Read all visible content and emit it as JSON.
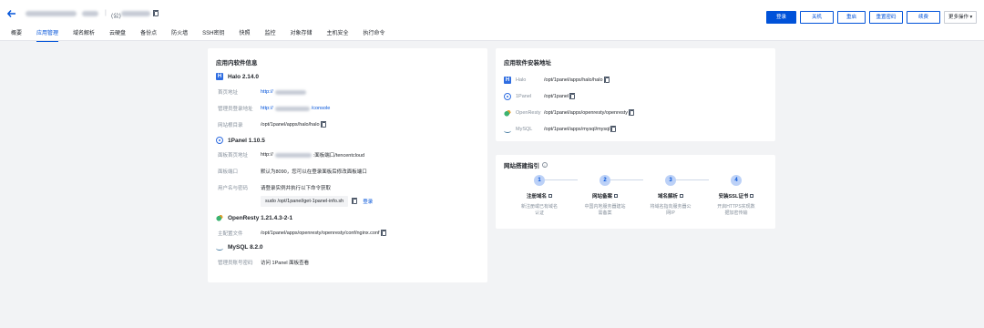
{
  "header": {
    "ip_prefix": "(公)",
    "buttons": [
      "登录",
      "关机",
      "重启",
      "重置密码",
      "续费",
      "更多操作"
    ]
  },
  "tabs": [
    "概要",
    "应用管理",
    "域名解析",
    "云硬盘",
    "备份点",
    "防火墙",
    "SSH密钥",
    "快照",
    "监控",
    "对象存储",
    "主机安全",
    "执行命令"
  ],
  "active_tab": "应用管理",
  "software_info": {
    "title": "应用内软件信息",
    "halo": {
      "name": "Halo 2.14.0",
      "homepage_label": "首页地址",
      "homepage_value": "http://",
      "admin_label": "管理员登录地址",
      "admin_value_prefix": "http://",
      "admin_value_suffix": "/console",
      "path_label": "网站根目录",
      "path_value": "/opt/1panel/apps/halo/halo"
    },
    "onepanel": {
      "name": "1Panel 1.10.5",
      "panel_label": "面板首页地址",
      "panel_value_prefix": "http://",
      "panel_value_suffix": ":面板端口/tencentcloud",
      "port_label": "面板端口",
      "port_value": "默认为8090，您可以在登录面板后修改面板端口",
      "cred_label": "用户名与密码",
      "cred_value": "请登录实例并执行以下命令获取",
      "command": "sudo /opt/1panel/get-1panel-info.sh",
      "login_link": "登录"
    },
    "openresty": {
      "name": "OpenResty 1.21.4.3-2-1",
      "config_label": "主配置文件",
      "config_value": "/opt/1panel/apps/openresty/openresty/conf/nginx.conf"
    },
    "mysql": {
      "name": "MySQL 8.2.0",
      "pwd_label": "管理员账号密码",
      "pwd_value": "访问 1Panel 面板查看"
    }
  },
  "install_paths": {
    "title": "应用软件安装地址",
    "items": [
      {
        "name": "Halo",
        "path": "/opt/1panel/apps/halo/halo",
        "icon": "halo-icon"
      },
      {
        "name": "1Panel",
        "path": "/opt/1panel",
        "icon": "1panel-icon"
      },
      {
        "name": "OpenResty",
        "path": "/opt/1panel/apps/openresty/openresty",
        "icon": "openresty-icon"
      },
      {
        "name": "MySQL",
        "path": "/opt/1panel/apps/mysql/mysql",
        "icon": "mysql-icon"
      }
    ]
  },
  "guide": {
    "title": "网站搭建指引",
    "steps": [
      {
        "num": "1",
        "title": "注册域名",
        "desc1": "新注册或已有域名",
        "desc2": "认证"
      },
      {
        "num": "2",
        "title": "网站备案",
        "desc1": "中国内地服务器建站",
        "desc2": "需备案"
      },
      {
        "num": "3",
        "title": "域名解析",
        "desc1": "将域名指向服务器公",
        "desc2": "网IP"
      },
      {
        "num": "4",
        "title": "安装SSL证书",
        "desc1": "开启HTTPS实现数",
        "desc2": "据加密传输"
      }
    ]
  }
}
